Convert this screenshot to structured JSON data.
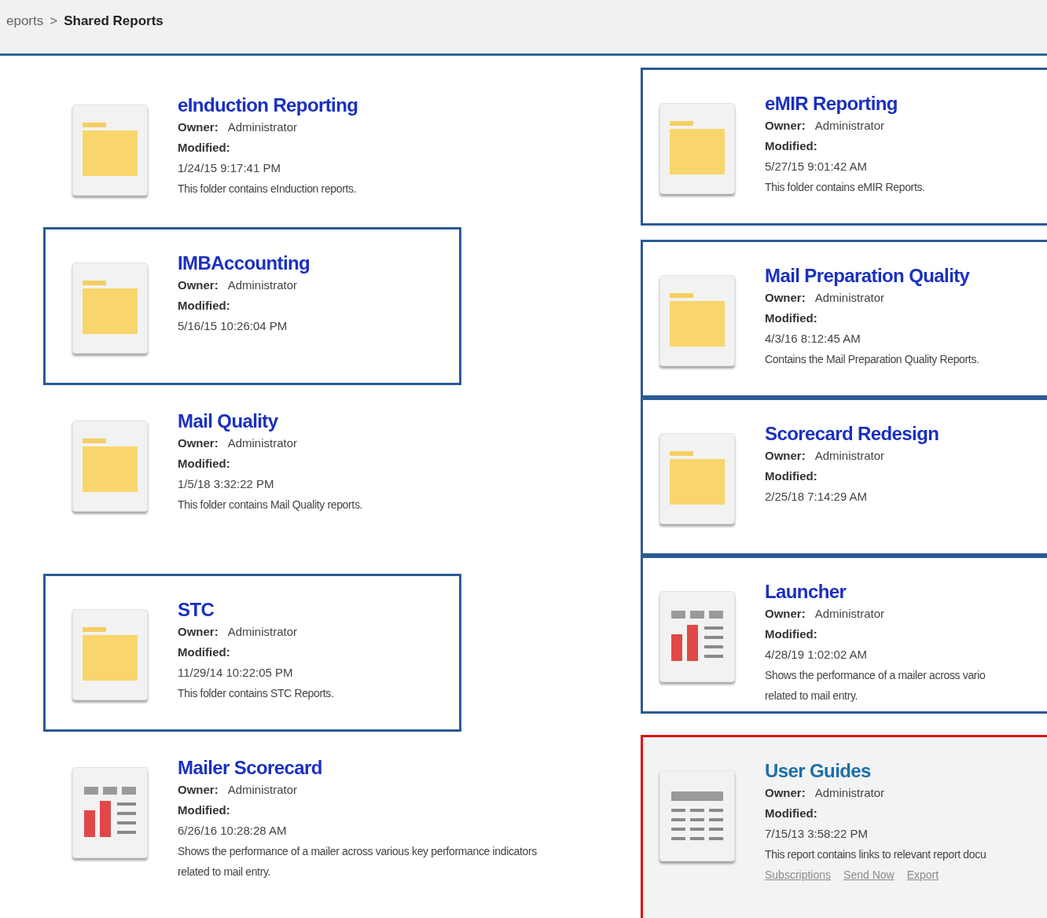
{
  "breadcrumb": [
    {
      "label": "eports",
      "current": false
    },
    {
      "label": "Shared Reports",
      "current": true
    }
  ],
  "breadcrumb_separator": ">",
  "columns": [
    {
      "items": [
        {
          "title": "eInduction Reporting",
          "kind": "folder",
          "outlined": false,
          "selected": false,
          "owner_label": "Owner:",
          "owner": "Administrator",
          "modified_label": "Modified:",
          "modified": "1/24/15 9:17:41 PM",
          "description": "This folder contains eInduction reports."
        },
        {
          "title": "IMBAccounting",
          "kind": "folder",
          "outlined": true,
          "selected": false,
          "owner_label": "Owner:",
          "owner": "Administrator",
          "modified_label": "Modified:",
          "modified": "5/16/15 10:26:04 PM"
        },
        {
          "title": "Mail Quality",
          "kind": "folder",
          "outlined": false,
          "selected": false,
          "owner_label": "Owner:",
          "owner": "Administrator",
          "modified_label": "Modified:",
          "modified": "1/5/18 3:32:22 PM",
          "description": "This folder contains Mail Quality reports."
        },
        {
          "title": "STC",
          "kind": "folder",
          "outlined": true,
          "selected": false,
          "owner_label": "Owner:",
          "owner": "Administrator",
          "modified_label": "Modified:",
          "modified": "11/29/14 10:22:05 PM",
          "description": "This folder contains STC Reports."
        },
        {
          "title": "Mailer Scorecard",
          "kind": "report",
          "outlined": false,
          "selected": false,
          "owner_label": "Owner:",
          "owner": "Administrator",
          "modified_label": "Modified:",
          "modified": "6/26/16 10:28:28 AM",
          "description": "Shows the performance of a mailer across various key performance indicators",
          "description_2": "related to mail entry."
        }
      ]
    },
    {
      "items": [
        {
          "title": "eMIR Reporting",
          "kind": "folder",
          "outlined": true,
          "selected": false,
          "owner_label": "Owner:",
          "owner": "Administrator",
          "modified_label": "Modified:",
          "modified": "5/27/15 9:01:42 AM",
          "description": "This folder contains eMIR Reports."
        },
        {
          "title": "Mail Preparation Quality",
          "kind": "folder",
          "outlined": true,
          "selected": false,
          "owner_label": "Owner:",
          "owner": "Administrator",
          "modified_label": "Modified:",
          "modified": "4/3/16 8:12:45 AM",
          "description": "Contains the Mail Preparation Quality Reports."
        },
        {
          "title": "Scorecard Redesign",
          "kind": "folder",
          "outlined": true,
          "selected": false,
          "owner_label": "Owner:",
          "owner": "Administrator",
          "modified_label": "Modified:",
          "modified": "2/25/18 7:14:29 AM"
        },
        {
          "title": "Launcher",
          "kind": "report",
          "outlined": true,
          "selected": false,
          "owner_label": "Owner:",
          "owner": "Administrator",
          "modified_label": "Modified:",
          "modified": "4/28/19 1:02:02 AM",
          "description": "Shows the performance of a mailer across vario",
          "description_2": "related to mail entry."
        },
        {
          "title": "User Guides",
          "kind": "list",
          "outlined": false,
          "selected": true,
          "owner_label": "Owner:",
          "owner": "Administrator",
          "modified_label": "Modified:",
          "modified": "7/15/13 3:58:22 PM",
          "description": "This report contains links to relevant report docu",
          "links": [
            "Subscriptions",
            "Send Now",
            "Export"
          ]
        }
      ]
    }
  ]
}
